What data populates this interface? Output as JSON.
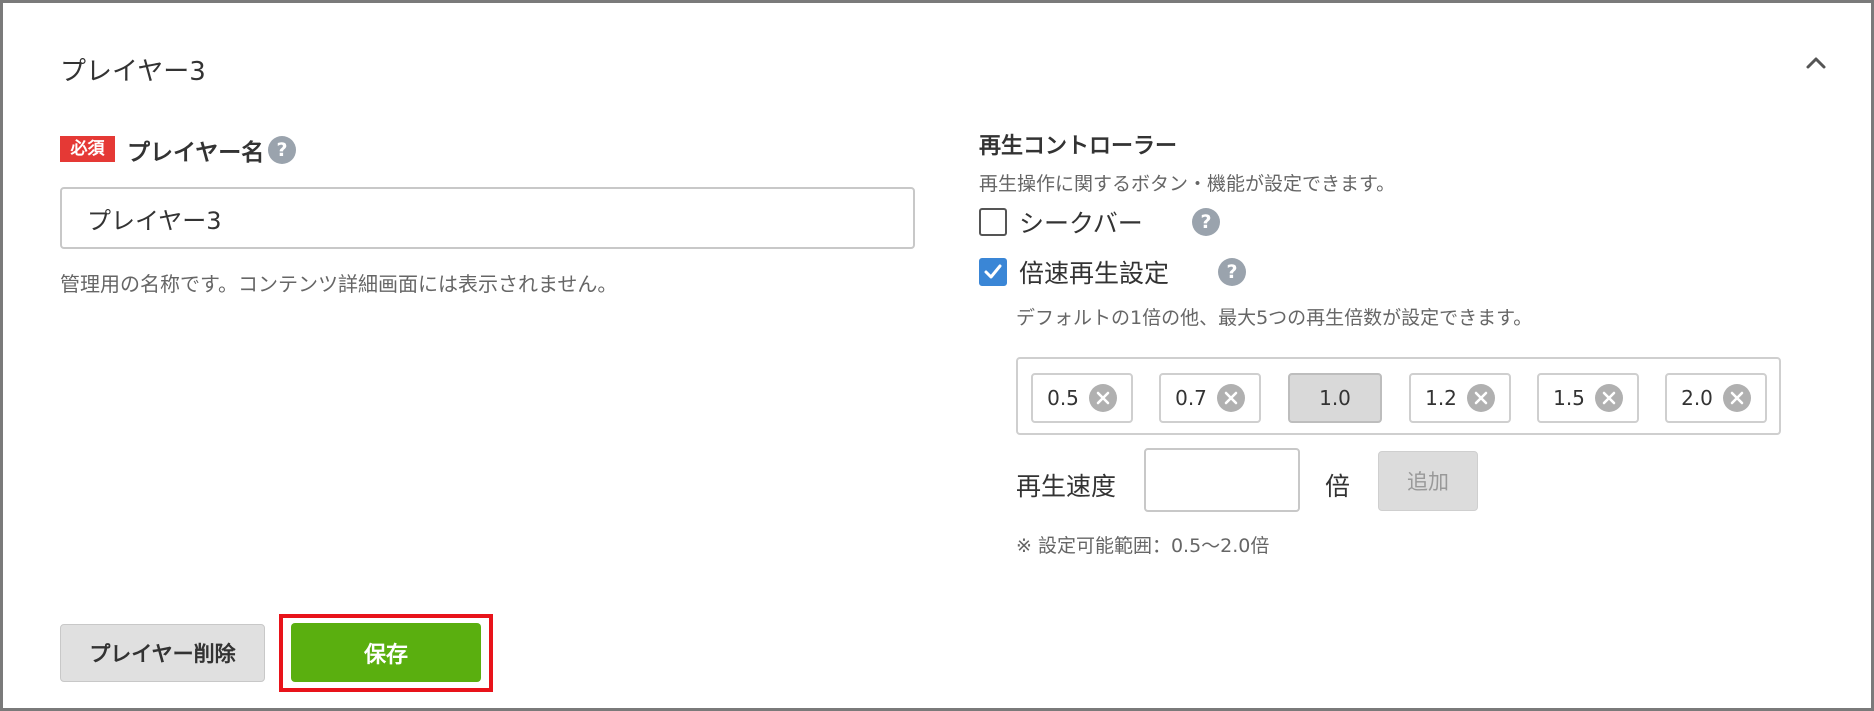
{
  "panel": {
    "title": "プレイヤー3",
    "collapse_icon": "chevron-up-icon"
  },
  "player_name": {
    "required_badge": "必須",
    "label": "プレイヤー名",
    "help_icon": "question-icon",
    "help_glyph": "?",
    "value": "プレイヤー3",
    "hint": "管理用の名称です。コンテンツ詳細画面には表示されません。"
  },
  "controller": {
    "title": "再生コントローラー",
    "description": "再生操作に関するボタン・機能が設定できます。",
    "seekbar": {
      "label": "シークバー",
      "checked": false
    },
    "speed": {
      "label": "倍速再生設定",
      "checked": true,
      "description": "デフォルトの1倍の他、最大5つの再生倍数が設定できます。",
      "chips": [
        {
          "value": "0.5",
          "removable": true
        },
        {
          "value": "0.7",
          "removable": true
        },
        {
          "value": "1.0",
          "removable": false
        },
        {
          "value": "1.2",
          "removable": true
        },
        {
          "value": "1.5",
          "removable": true
        },
        {
          "value": "2.0",
          "removable": true
        }
      ],
      "input_label": "再生速度",
      "input_value": "",
      "unit": "倍",
      "add_label": "追加",
      "range_note": "※ 設定可能範囲：0.5〜2.0倍"
    }
  },
  "actions": {
    "delete_label": "プレイヤー削除",
    "save_label": "保存"
  },
  "colors": {
    "required": "#e53935",
    "save": "#5aaf0f",
    "checkbox": "#3a86d6",
    "highlight": "#e8131a"
  }
}
